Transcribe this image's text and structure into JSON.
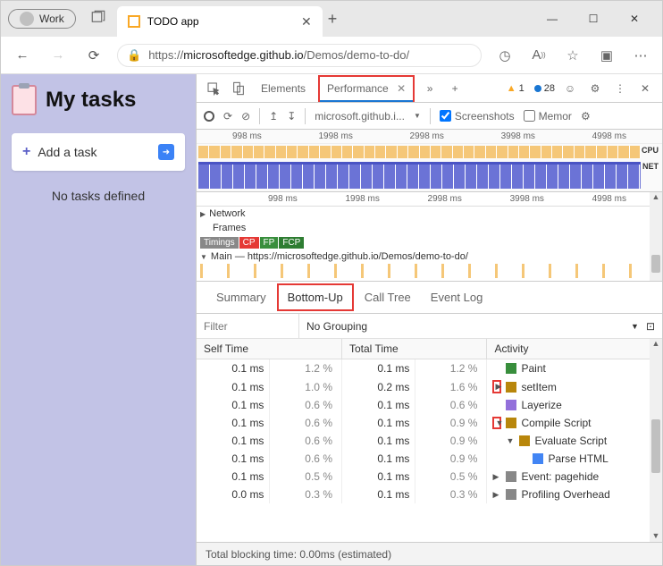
{
  "window": {
    "profile": "Work",
    "min": "—",
    "max": "☐",
    "close": "✕"
  },
  "tab": {
    "title": "TODO app",
    "close": "✕",
    "new": "+"
  },
  "url": {
    "scheme": "https://",
    "host": "microsoftedge.github.io",
    "path": "/Demos/demo-to-do/"
  },
  "app": {
    "title": "My tasks",
    "add_label": "Add a task",
    "empty": "No tasks defined"
  },
  "devtools": {
    "tabs": {
      "elements": "Elements",
      "performance": "Performance"
    },
    "warnings": "1",
    "info": "28",
    "toolbar": {
      "source": "microsoft.github.i...",
      "screenshots": "Screenshots",
      "memory": "Memor"
    },
    "ruler": [
      "998 ms",
      "1998 ms",
      "2998 ms",
      "3998 ms",
      "4998 ms"
    ],
    "cpu": "CPU",
    "net": "NET",
    "tracks": {
      "network": "Network",
      "frames": "Frames",
      "timings": "Timings",
      "fcp": "CP",
      "fp": "FP",
      "fcp2": "FCP",
      "main": "Main — https://microsoftedge.github.io/Demos/demo-to-do/"
    },
    "analysis": {
      "summary": "Summary",
      "bottomup": "Bottom-Up",
      "calltree": "Call Tree",
      "eventlog": "Event Log"
    },
    "filter_ph": "Filter",
    "grouping": "No Grouping",
    "headers": {
      "self": "Self Time",
      "total": "Total Time",
      "activity": "Activity"
    },
    "rows": [
      {
        "self_ms": "0.1 ms",
        "self_pct": "1.2 %",
        "total_ms": "0.1 ms",
        "total_pct": "1.2 %",
        "indent": 0,
        "exp": "",
        "color": "#388e3c",
        "label": "Paint",
        "hl": false
      },
      {
        "self_ms": "0.1 ms",
        "self_pct": "1.0 %",
        "total_ms": "0.2 ms",
        "total_pct": "1.6 %",
        "indent": 0,
        "exp": "▶",
        "color": "#b8860b",
        "label": "setItem",
        "hl": true
      },
      {
        "self_ms": "0.1 ms",
        "self_pct": "0.6 %",
        "total_ms": "0.1 ms",
        "total_pct": "0.6 %",
        "indent": 0,
        "exp": "",
        "color": "#9370db",
        "label": "Layerize",
        "hl": false
      },
      {
        "self_ms": "0.1 ms",
        "self_pct": "0.6 %",
        "total_ms": "0.1 ms",
        "total_pct": "0.9 %",
        "indent": 0,
        "exp": "▼",
        "color": "#b8860b",
        "label": "Compile Script",
        "hl": true
      },
      {
        "self_ms": "0.1 ms",
        "self_pct": "0.6 %",
        "total_ms": "0.1 ms",
        "total_pct": "0.9 %",
        "indent": 1,
        "exp": "▼",
        "color": "#b8860b",
        "label": "Evaluate Script",
        "hl": false
      },
      {
        "self_ms": "0.1 ms",
        "self_pct": "0.6 %",
        "total_ms": "0.1 ms",
        "total_pct": "0.9 %",
        "indent": 2,
        "exp": "",
        "color": "#4285f4",
        "label": "Parse HTML",
        "hl": false
      },
      {
        "self_ms": "0.1 ms",
        "self_pct": "0.5 %",
        "total_ms": "0.1 ms",
        "total_pct": "0.5 %",
        "indent": 0,
        "exp": "▶",
        "color": "#888",
        "label": "Event: pagehide",
        "hl": false
      },
      {
        "self_ms": "0.0 ms",
        "self_pct": "0.3 %",
        "total_ms": "0.1 ms",
        "total_pct": "0.3 %",
        "indent": 0,
        "exp": "▶",
        "color": "#888",
        "label": "Profiling Overhead",
        "hl": false
      }
    ],
    "footer": "Total blocking time: 0.00ms (estimated)"
  }
}
